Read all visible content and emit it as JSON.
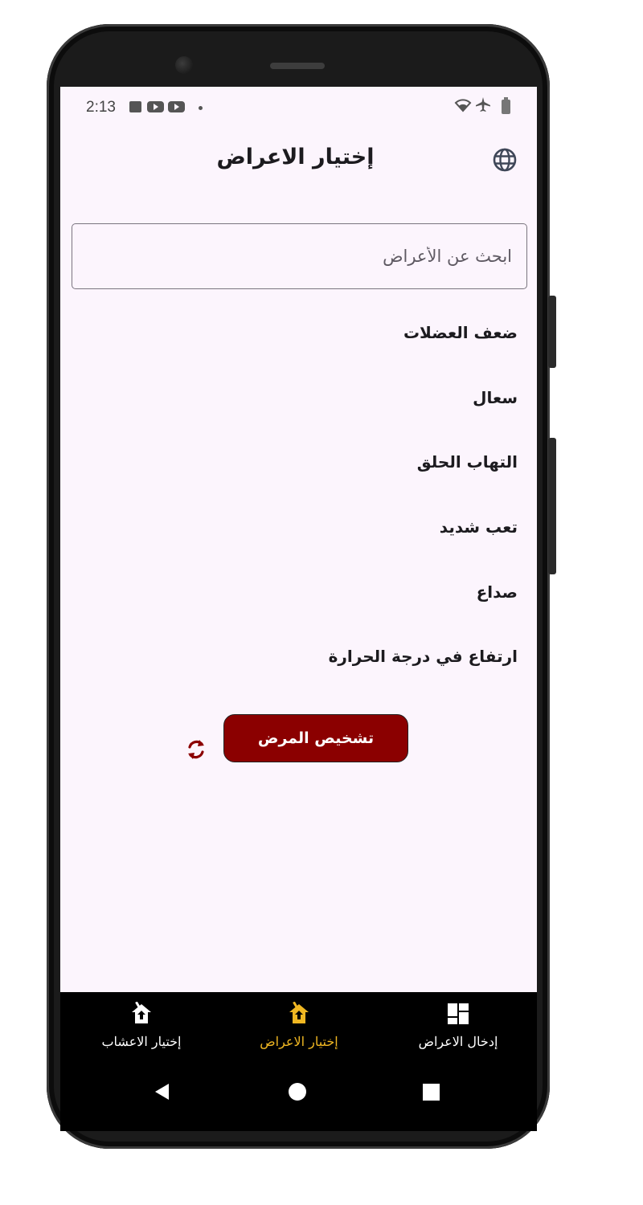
{
  "status_bar": {
    "time": "2:13"
  },
  "header": {
    "title": "إختيار الاعراض",
    "language_icon": "globe-icon"
  },
  "search": {
    "placeholder": "ابحث عن الأعراض",
    "value": ""
  },
  "symptoms": [
    {
      "label": "ضعف العضلات"
    },
    {
      "label": "سعال"
    },
    {
      "label": "التهاب الحلق"
    },
    {
      "label": "تعب شديد"
    },
    {
      "label": "صداع"
    },
    {
      "label": "ارتفاع في درجة الحرارة"
    }
  ],
  "actions": {
    "diagnose_label": "تشخيص المرض",
    "refresh_icon": "refresh-icon"
  },
  "bottom_nav": {
    "items": [
      {
        "label": "إختيار الاعشاب",
        "icon": "home-up-icon",
        "active": false
      },
      {
        "label": "إختيار الاعراض",
        "icon": "home-up-icon",
        "active": true
      },
      {
        "label": "إدخال الاعراض",
        "icon": "dashboard-icon",
        "active": false
      }
    ]
  },
  "colors": {
    "screen_background": "#fcf5fd",
    "primary_button": "#8b0000",
    "active_nav": "#f0b722",
    "nav_background": "#000000"
  }
}
